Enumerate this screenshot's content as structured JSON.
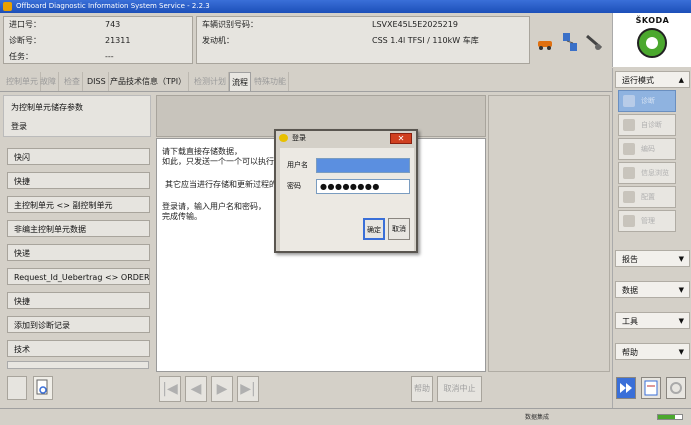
{
  "window": {
    "title": "Offboard Diagnostic Information System Service - 2.2.3"
  },
  "header": {
    "left": [
      {
        "label": "进口号：",
        "value": "743"
      },
      {
        "label": "诊断号：",
        "value": "21311"
      },
      {
        "label": "任务：",
        "value": "---"
      }
    ],
    "right": [
      {
        "label": "车辆识别号码：",
        "value": "LSVXE45L5E2025219"
      },
      {
        "label": "发动机：",
        "value": "CSS 1.4l TFSI / 110kW 车库"
      }
    ],
    "icons": [
      "car-key-icon",
      "network-icon",
      "tools-icon"
    ]
  },
  "logo": {
    "brand": "ŠKODA"
  },
  "tabs": [
    {
      "label": "控制单元",
      "state": "disabled"
    },
    {
      "label": "故障",
      "state": "disabled"
    },
    {
      "label": "检查",
      "state": "disabled"
    },
    {
      "label": "DISS",
      "state": "normal"
    },
    {
      "label": "产品技术信息（TPI）",
      "state": "normal"
    },
    {
      "label": "检测计划",
      "state": "disabled"
    },
    {
      "label": "流程",
      "state": "active"
    },
    {
      "label": "特殊功能",
      "state": "disabled"
    }
  ],
  "left_panel": {
    "header_title": "为控制单元储存参数",
    "header_sub": "登录",
    "items": [
      "快闪",
      "快捷",
      "主控制单元 <> 副控制单元",
      "非编主控制单元数据",
      "快递",
      "Request_Id_Uebertrag <> ORDER_R",
      "快捷",
      "添加到诊断记录",
      "技术"
    ]
  },
  "main": {
    "text_lines_1": [
      "请下载直接存储数据，",
      "如此，只发送一个一个可以执行。"
    ],
    "text_lines_2": [
      "其它应当进行存储和更新过程的诊断。"
    ],
    "text_lines_3": [
      "登录请，输入用户名和密码，",
      "完成传输。"
    ]
  },
  "nav": {
    "buttons": [
      "|◀",
      "◀",
      "▶",
      "▶|"
    ],
    "help_label": "帮助",
    "cancel_label": "取消中止"
  },
  "sidebar": {
    "mode_label": "运行模式",
    "mode_buttons": [
      {
        "label": "诊断",
        "active": true
      },
      {
        "label": "自诊断",
        "active": false
      },
      {
        "label": "编码",
        "active": false
      },
      {
        "label": "信息浏览",
        "active": false
      },
      {
        "label": "配置",
        "active": false
      },
      {
        "label": "管理",
        "active": false
      }
    ],
    "sections": [
      "报告",
      "数据",
      "工具",
      "帮助"
    ]
  },
  "status": {
    "text": "数据集成",
    "progress": 0.7
  },
  "dialog": {
    "title": "登录",
    "user_label": "用户名",
    "pass_label": "密码",
    "user_value": "",
    "pass_value": "●●●●●●●●",
    "ok_label": "确定",
    "cancel_label": "取消"
  },
  "colors": {
    "brand_green": "#4ba82e",
    "active_blue": "#8fb3e0",
    "selection_blue": "#5b8fe0"
  }
}
